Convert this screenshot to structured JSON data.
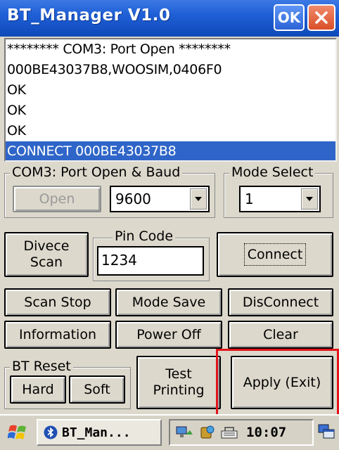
{
  "window": {
    "title": "BT_Manager V1.0",
    "ok_label": "OK"
  },
  "log": [
    "******** COM3: Port Open ********",
    "000BE43037B8,WOOSIM,0406F0",
    "OK",
    "OK",
    "OK",
    "CONNECT 000BE43037B8"
  ],
  "com_group": {
    "legend": "COM3: Port Open & Baud",
    "open_label": "Open",
    "baud_value": "9600"
  },
  "mode_group": {
    "legend": "Mode Select",
    "mode_value": "1"
  },
  "pin_group": {
    "legend": "Pin Code",
    "pin_value": "1234"
  },
  "buttons": {
    "device_scan": "Divece Scan",
    "connect": "Connect",
    "scan_stop": "Scan Stop",
    "mode_save": "Mode Save",
    "disconnect": "DisConnect",
    "information": "Information",
    "power_off": "Power Off",
    "clear": "Clear",
    "test_printing": "Test Printing",
    "apply_exit": "Apply (Exit)"
  },
  "reset_group": {
    "legend": "BT Reset",
    "hard": "Hard",
    "soft": "Soft"
  },
  "taskbar": {
    "task_label": "BT_Man...",
    "clock": "10:07"
  }
}
